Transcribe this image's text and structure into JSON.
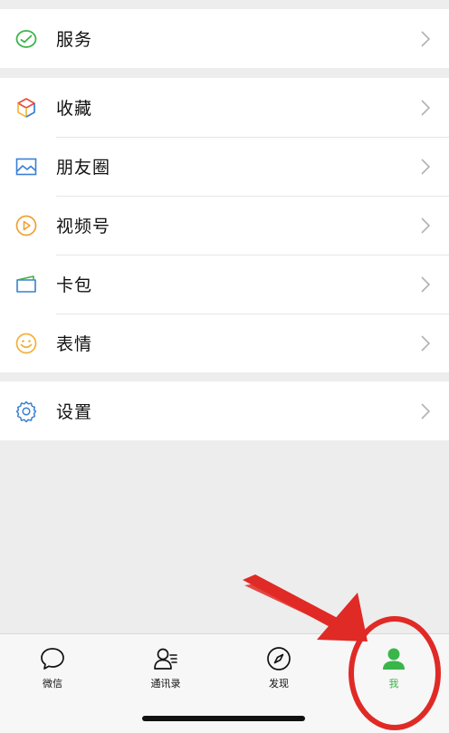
{
  "groups": [
    {
      "items": [
        {
          "label": "服务",
          "icon": "service-icon"
        }
      ]
    },
    {
      "items": [
        {
          "label": "收藏",
          "icon": "favorites-icon"
        },
        {
          "label": "朋友圈",
          "icon": "moments-icon"
        },
        {
          "label": "视频号",
          "icon": "channels-icon"
        },
        {
          "label": "卡包",
          "icon": "card-wallet-icon"
        },
        {
          "label": "表情",
          "icon": "sticker-icon"
        }
      ]
    },
    {
      "items": [
        {
          "label": "设置",
          "icon": "settings-icon"
        }
      ]
    }
  ],
  "tabbar": {
    "tabs": [
      {
        "label": "微信",
        "icon": "chat-bubble-icon"
      },
      {
        "label": "通讯录",
        "icon": "contacts-icon"
      },
      {
        "label": "发现",
        "icon": "compass-icon"
      },
      {
        "label": "我",
        "icon": "person-icon",
        "active": true
      }
    ]
  },
  "colors": {
    "active": "#3ab54a",
    "annotation": "#e02a26"
  }
}
